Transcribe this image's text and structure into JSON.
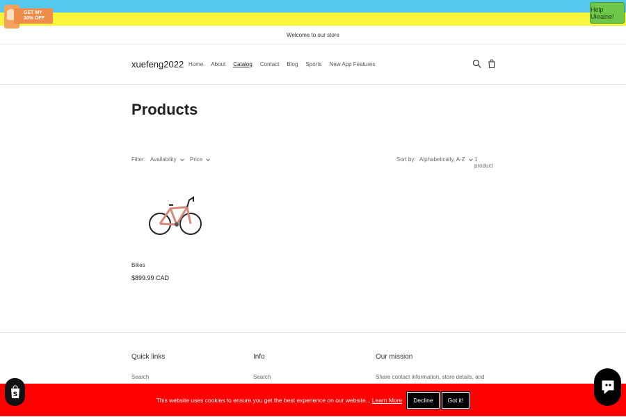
{
  "promo": {
    "line1": "GET MY",
    "line2": "30% OFF"
  },
  "help": {
    "label": "Help Ukraine!"
  },
  "announcement": "Welcome to our store",
  "header": {
    "logo": "xuefeng2022",
    "nav": [
      {
        "label": "Home"
      },
      {
        "label": "About"
      },
      {
        "label": "Catalog",
        "active": true
      },
      {
        "label": "Contact"
      },
      {
        "label": "Blog"
      },
      {
        "label": "Sports"
      },
      {
        "label": "New App Features"
      }
    ]
  },
  "page": {
    "title": "Products"
  },
  "facets": {
    "filter_label": "Filter:",
    "availability": "Availability",
    "price": "Price",
    "sort_label": "Sort by:",
    "sort_value": "Alphabetically, A-Z",
    "count": "1 product"
  },
  "products": [
    {
      "name": "Bikes",
      "price": "$899.99 CAD"
    }
  ],
  "footer": {
    "quick_links": {
      "heading": "Quick links",
      "item": "Search"
    },
    "info": {
      "heading": "Info",
      "item": "Search"
    },
    "mission": {
      "heading": "Our mission",
      "text": "Share contact information, store details, and"
    }
  },
  "cookie": {
    "message": "This website uses cookies to ensure you get the best experience on our website...",
    "learn_more": "Learn More",
    "decline": "Decline",
    "accept": "Got it!"
  },
  "colors": {
    "banner_blue": "#56c8f0",
    "banner_yellow": "#f9f53b",
    "cookie_red": "#ff0000"
  }
}
